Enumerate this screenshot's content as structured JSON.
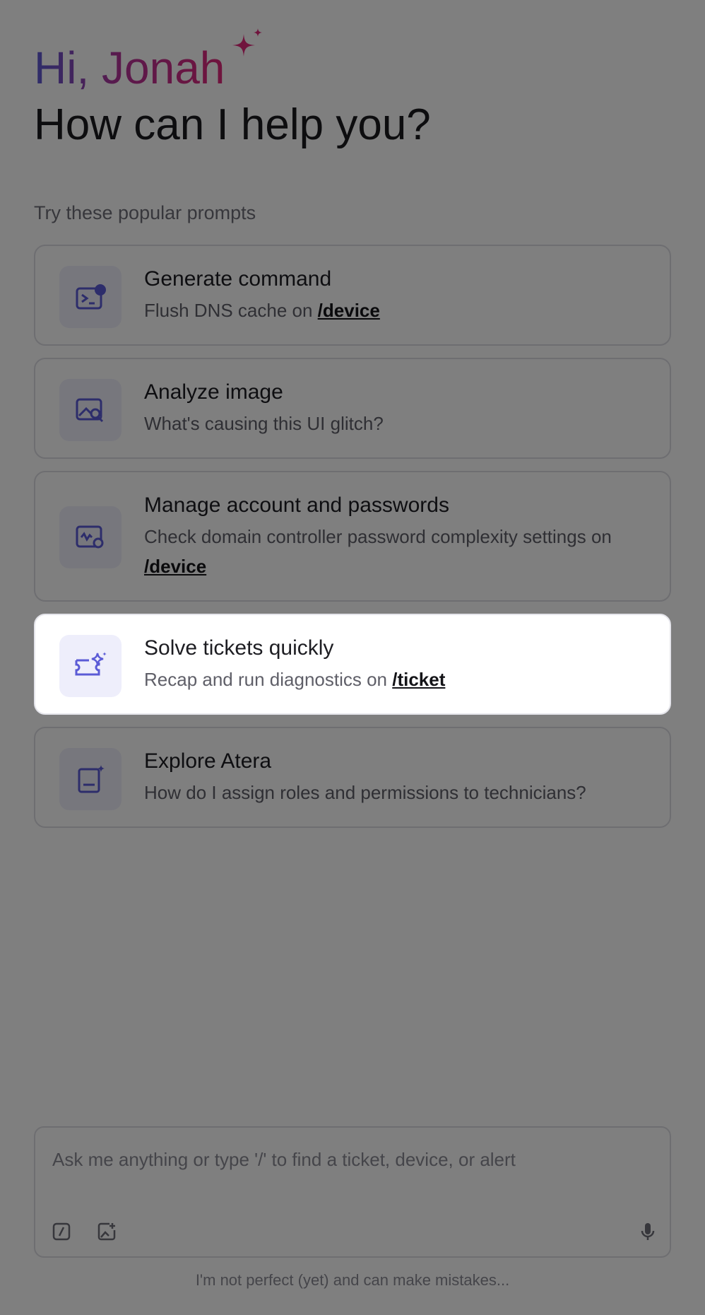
{
  "greeting": "Hi, Jonah",
  "headline": "How can I help you?",
  "prompts_label": "Try these popular prompts",
  "prompts": [
    {
      "icon": "terminal-icon",
      "title": "Generate command",
      "desc": "Flush DNS cache on ",
      "link": "/device"
    },
    {
      "icon": "image-search-icon",
      "title": "Analyze image",
      "desc": "What's causing this UI glitch?",
      "link": ""
    },
    {
      "icon": "password-settings-icon",
      "title": "Manage account and passwords",
      "desc": "Check domain controller password complexity settings on ",
      "link": "/device"
    },
    {
      "icon": "ticket-sparkle-icon",
      "title": "Solve tickets quickly",
      "desc": "Recap and run diagnostics on ",
      "link": "/ticket"
    },
    {
      "icon": "book-sparkle-icon",
      "title": "Explore Atera",
      "desc": "How do I assign roles and permissions to technicians?",
      "link": ""
    }
  ],
  "input": {
    "placeholder": "Ask me anything or type '/' to find a ticket, device, or alert",
    "icons": [
      "slash-command-icon",
      "image-upload-icon",
      "microphone-icon"
    ]
  },
  "disclaimer": "I'm not perfect (yet) and can make mistakes...",
  "colors": {
    "accent": "#5b5bd6",
    "pink": "#e0287a",
    "icon_bg": "#eeeefb",
    "overlay": "rgba(0,0,0,0.5)"
  }
}
